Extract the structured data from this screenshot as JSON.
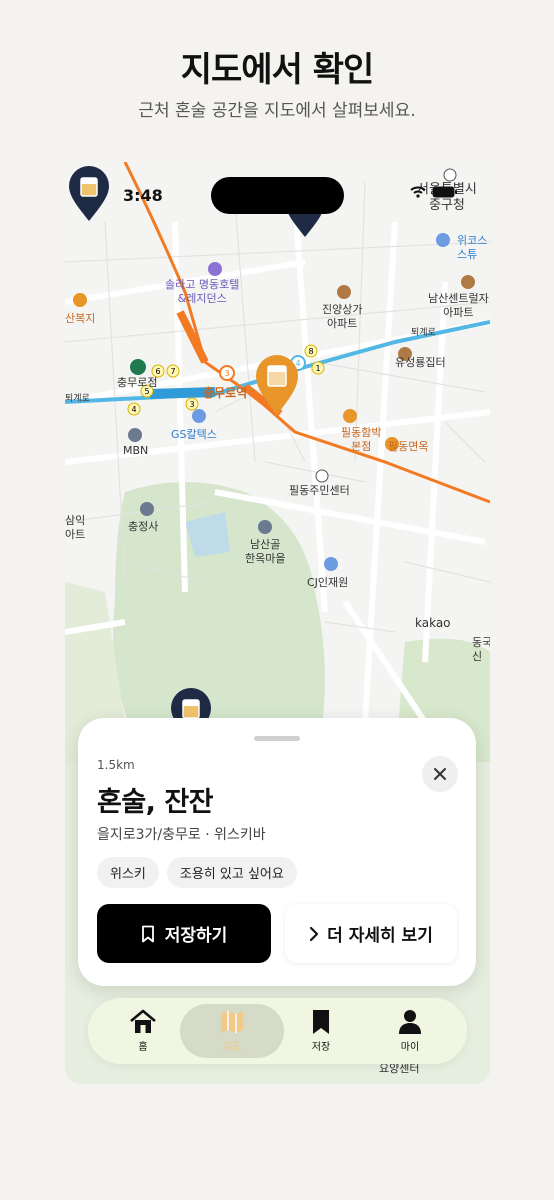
{
  "headline": "지도에서 확인",
  "subline": "근처 혼술 공간을 지도에서 살펴보세요.",
  "status": {
    "time": "3:48"
  },
  "map_labels": {
    "solago": "솔라고 명동호텔\n&레지던스",
    "jinyang": "진양상가\n아파트",
    "namsan_central": "남산센트럴자\n아파트",
    "yuseong": "유성룡집터",
    "seoul_junggu": "서울특별시\n중구청",
    "wekos": "위코스\n스튜",
    "chungmuro_station": "충무로역",
    "chungmuro_jeom": "충무로점",
    "gs_caltex": "GS칼텍스",
    "mbn": "MBN",
    "pildong_hambak": "필동함박\n본점",
    "pildong_myeonok": "필동면옥",
    "pildong_center": "필동주민센터",
    "chungjeongsa": "충정사",
    "namsangol": "남산골\n한옥마을",
    "cj": "CJ인재원",
    "kakao": "kakao",
    "toegyero_left": "퇴계로",
    "toegyero_right": "퇴계로",
    "sanbokji": "산복지",
    "samik": "삼익\n아트",
    "dongguk": "동국\n신",
    "yoyang": "요양센터"
  },
  "sheet": {
    "distance": "1.5km",
    "name": "혼술, 잔잔",
    "subtitle": "을지로3가/충무로 · 위스키바",
    "tags": [
      "위스키",
      "조용히 있고 싶어요"
    ],
    "save_label": "저장하기",
    "more_label": "더 자세히 보기"
  },
  "tabbar": {
    "items": [
      {
        "label": "홈",
        "icon": "home-icon"
      },
      {
        "label": "지도",
        "icon": "map-icon",
        "active": true
      },
      {
        "label": "저장",
        "icon": "bookmark-icon"
      },
      {
        "label": "마이",
        "icon": "person-icon"
      }
    ]
  },
  "colors": {
    "accent_orange": "#e8952a",
    "pin_navy": "#1f2a44",
    "button_black": "#000000"
  }
}
